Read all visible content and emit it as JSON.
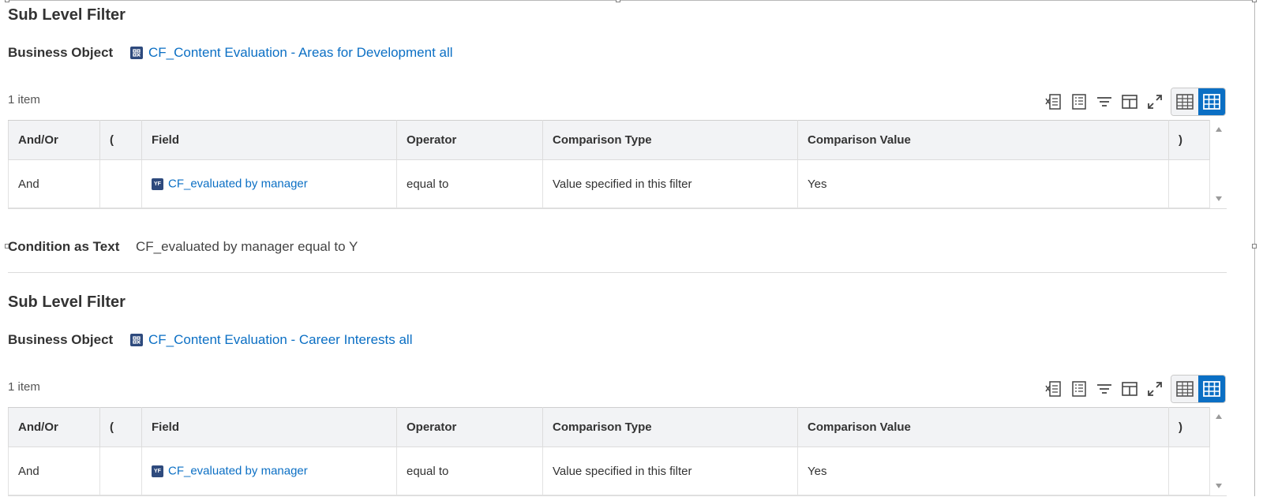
{
  "sections": [
    {
      "title": "Sub Level Filter",
      "business_object_label": "Business Object",
      "business_object_value": "CF_Content Evaluation - Areas for Development all",
      "item_count": "1 item",
      "columns": [
        "And/Or",
        "(",
        "Field",
        "Operator",
        "Comparison Type",
        "Comparison Value",
        ")"
      ],
      "rows": [
        {
          "and_or": "And",
          "open_paren": "",
          "field": "CF_evaluated by manager",
          "operator": "equal to",
          "comparison_type": "Value specified in this filter",
          "comparison_value": "Yes",
          "close_paren": ""
        }
      ]
    },
    {
      "title": "Sub Level Filter",
      "business_object_label": "Business Object",
      "business_object_value": "CF_Content Evaluation - Career Interests all",
      "item_count": "1 item",
      "columns": [
        "And/Or",
        "(",
        "Field",
        "Operator",
        "Comparison Type",
        "Comparison Value",
        ")"
      ],
      "rows": [
        {
          "and_or": "And",
          "open_paren": "",
          "field": "CF_evaluated by manager",
          "operator": "equal to",
          "comparison_type": "Value specified in this filter",
          "comparison_value": "Yes",
          "close_paren": ""
        }
      ]
    }
  ],
  "condition": {
    "label": "Condition as Text",
    "text": "CF_evaluated by manager equal to Y"
  },
  "icons": {
    "business_object": "business-object-icon",
    "field": "field-type-icon",
    "field_glyph": "YF",
    "toolbar": [
      "export-excel-icon",
      "export-pdf-icon",
      "filter-icon",
      "columns-icon",
      "fullscreen-icon"
    ],
    "view": [
      "table-view-icon",
      "grid-view-icon"
    ]
  },
  "colors": {
    "link": "#0b6fc4",
    "icon_badge": "#2e4a7d",
    "active_toggle": "#0b6fc4",
    "header_bg": "#f2f3f5"
  }
}
